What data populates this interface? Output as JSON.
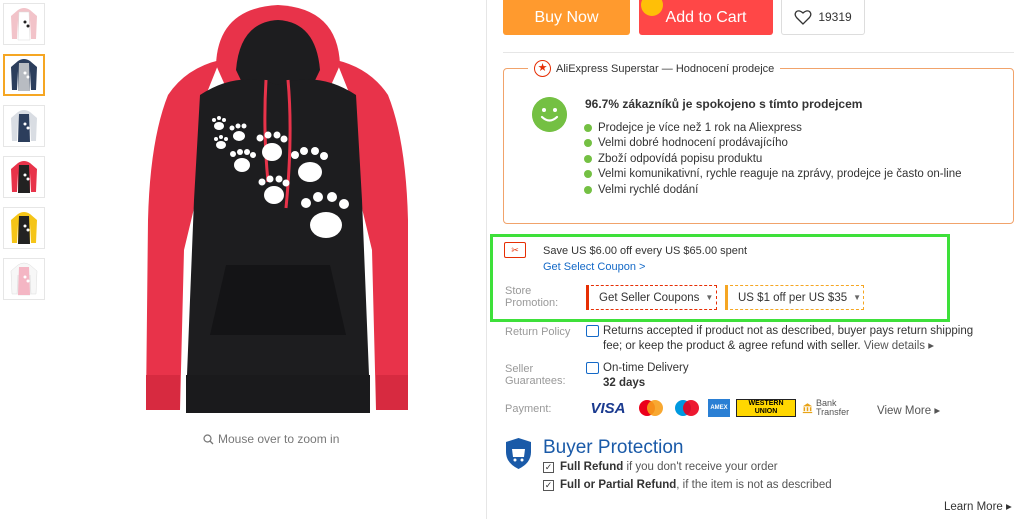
{
  "actions": {
    "buy_now": "Buy Now",
    "add_to_cart": "Add to Cart",
    "wishlist_count": "19319"
  },
  "gallery": {
    "zoom_hint": "Mouse over to zoom in",
    "thumbnails": [
      "white-black",
      "grey-navy",
      "navy-white",
      "black-red",
      "black-yellow",
      "pink-white"
    ],
    "selected_thumbnail": 1
  },
  "superstar": {
    "title": "AliExpress Superstar — Hodnocení prodejce",
    "headline": "96.7% zákazníků je spokojeno s tímto prodejcem",
    "items": [
      "Prodejce je více než 1 rok na Aliexpress",
      "Velmi dobré hodnocení prodávajícího",
      "Zboží odpovídá popisu produktu",
      "Velmi komunikativní, rychle reaguje na zprávy, prodejce je často on-line",
      "Velmi rychlé dodání"
    ]
  },
  "coupon": {
    "save_text": "Save US $6.00 off every US $65.00 spent",
    "link_text": "Get Select Coupon >",
    "store_promotion_label": "Store Promotion:",
    "seller_coupons": "Get Seller Coupons",
    "promo": "US $1 off per US $35"
  },
  "return_policy": {
    "label": "Return Policy",
    "text": "Returns accepted if product not as described, buyer pays return shipping fee; or keep the product & agree refund with seller.",
    "link": "View details"
  },
  "guarantees": {
    "label": "Seller Guarantees:",
    "delivery": "On-time Delivery",
    "days": "32 days"
  },
  "payment": {
    "label": "Payment:",
    "methods": [
      "VISA",
      "MasterCard",
      "Maestro",
      "AMEX",
      "WESTERN UNION",
      "Bank Transfer"
    ],
    "view_more": "View More"
  },
  "buyer_protection": {
    "title": "Buyer Protection",
    "full_refund": "Full Refund",
    "full_refund_text": "if you don't receive your order",
    "partial_refund": "Full or Partial Refund",
    "partial_refund_text": ", if the item is not as described",
    "learn_more": "Learn More"
  },
  "colors": {
    "buy": "#ff9a2e",
    "cart": "#ff4747",
    "highlight": "#3ee03a",
    "link": "#1469c7"
  }
}
